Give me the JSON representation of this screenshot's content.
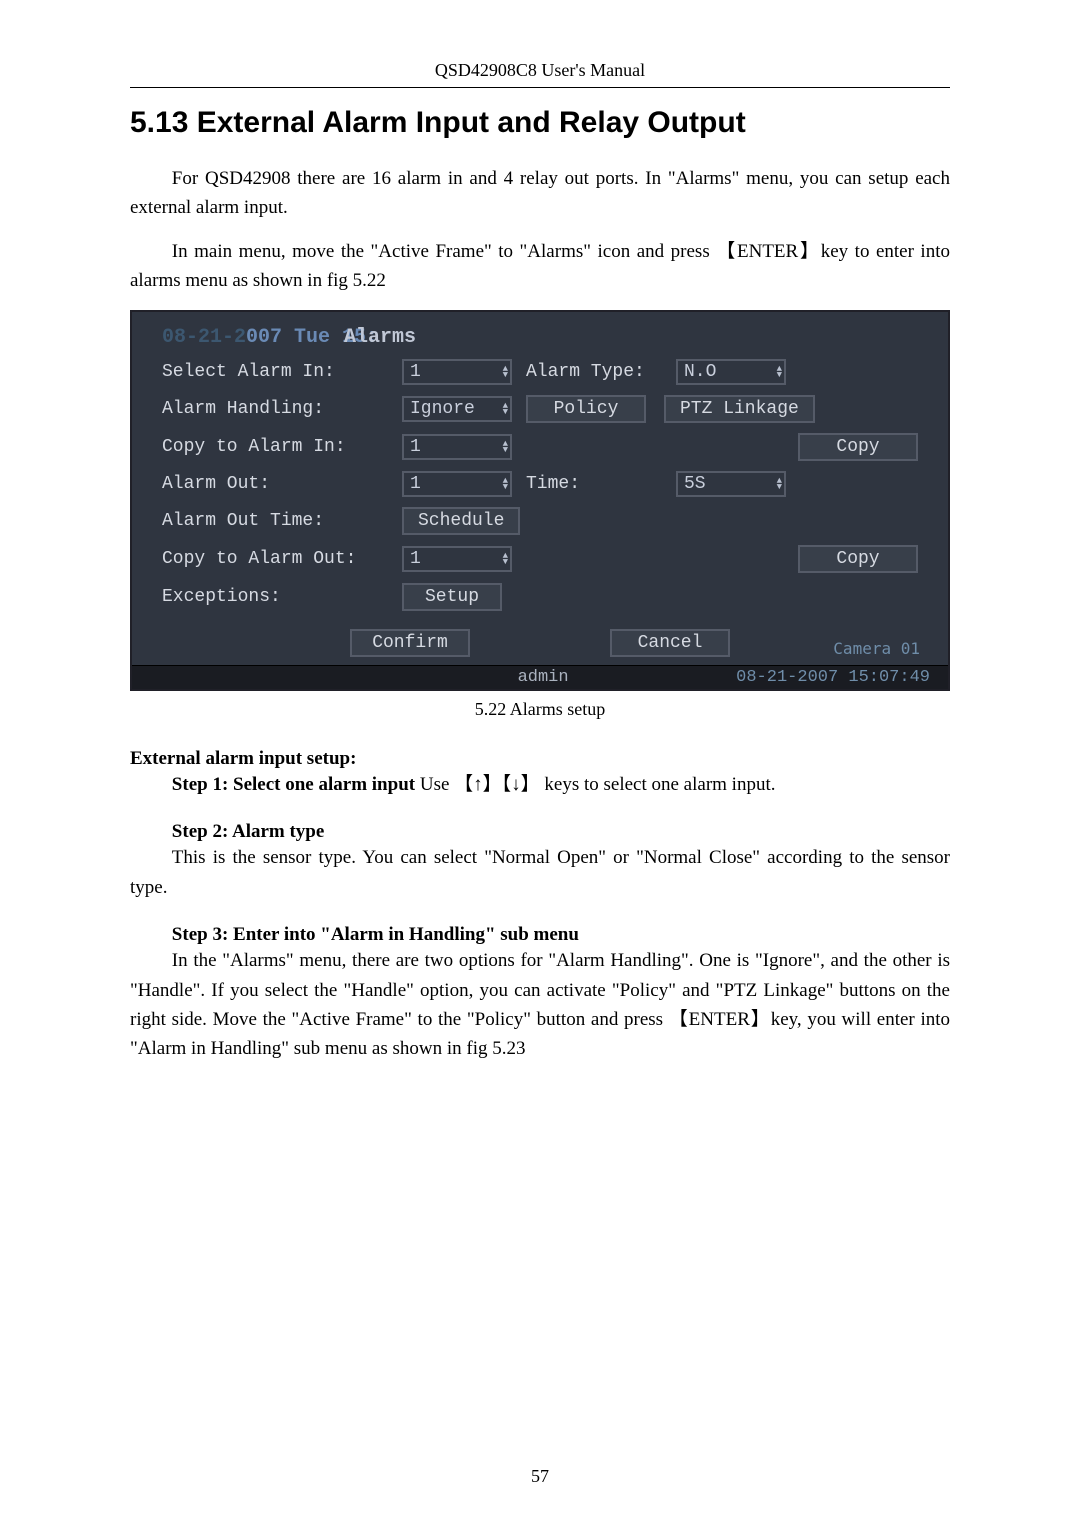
{
  "running_header": "QSD42908C8 User's Manual",
  "section_title": "5.13  External Alarm Input and Relay Output",
  "para1": "For QSD42908 there are 16 alarm in and 4 relay out ports. In \"Alarms\" menu, you can setup each external alarm input.",
  "para2": "In main menu, move the \"Active Frame\" to \"Alarms\" icon and press 【ENTER】key to enter into alarms menu as shown in fig 5.22",
  "ui": {
    "datetime_prefix": "08-21-2",
    "datetime_mid": "007 Tue 15:",
    "datetime_overlay": "Alarms",
    "select_alarm_in_label": "Select Alarm In:",
    "select_alarm_in_value": "1",
    "alarm_type_label": "Alarm Type:",
    "alarm_type_value": "N.O",
    "alarm_handling_label": "Alarm Handling:",
    "alarm_handling_value": "Ignore",
    "policy_btn": "Policy",
    "ptz_btn": "PTZ Linkage",
    "copy_to_alarm_in_label": "Copy to Alarm In:",
    "copy_to_alarm_in_value": "1",
    "copy_btn": "Copy",
    "alarm_out_label": "Alarm Out:",
    "alarm_out_value": "1",
    "time_label": "Time:",
    "time_value": "5S",
    "alarm_out_time_label": "Alarm Out Time:",
    "schedule_btn": "Schedule",
    "copy_to_alarm_out_label": "Copy to Alarm Out:",
    "copy_to_alarm_out_value": "1",
    "copy_btn2": "Copy",
    "exceptions_label": "Exceptions:",
    "setup_btn": "Setup",
    "confirm_btn": "Confirm",
    "cancel_btn": "Cancel",
    "status_user": "admin",
    "status_cam": "Camera 01",
    "status_ts": "08-21-2007 15:07:49"
  },
  "caption": "5.22 Alarms setup",
  "ext_setup_heading": "External alarm input setup:",
  "step1_label": "Step 1: Select one alarm input",
  "step1_text": " Use 【↑】【↓】 keys to select one alarm input.",
  "step2_label": "Step 2: Alarm type",
  "step2_text": "This is the sensor type. You can select \"Normal Open\" or \"Normal Close\" according to the sensor type.",
  "step3_label": "Step 3: Enter into \"Alarm in Handling\" sub menu",
  "step3_text": "In the \"Alarms\" menu, there are two options for \"Alarm Handling\".   One is \"Ignore\", and the other is \"Handle\". If you select the \"Handle\" option, you can activate \"Policy\" and \"PTZ Linkage\" buttons on the right side. Move the \"Active Frame\" to the \"Policy\" button and press 【ENTER】key, you will enter into \"Alarm in Handling\" sub menu as shown in fig 5.23",
  "page_number": "57"
}
